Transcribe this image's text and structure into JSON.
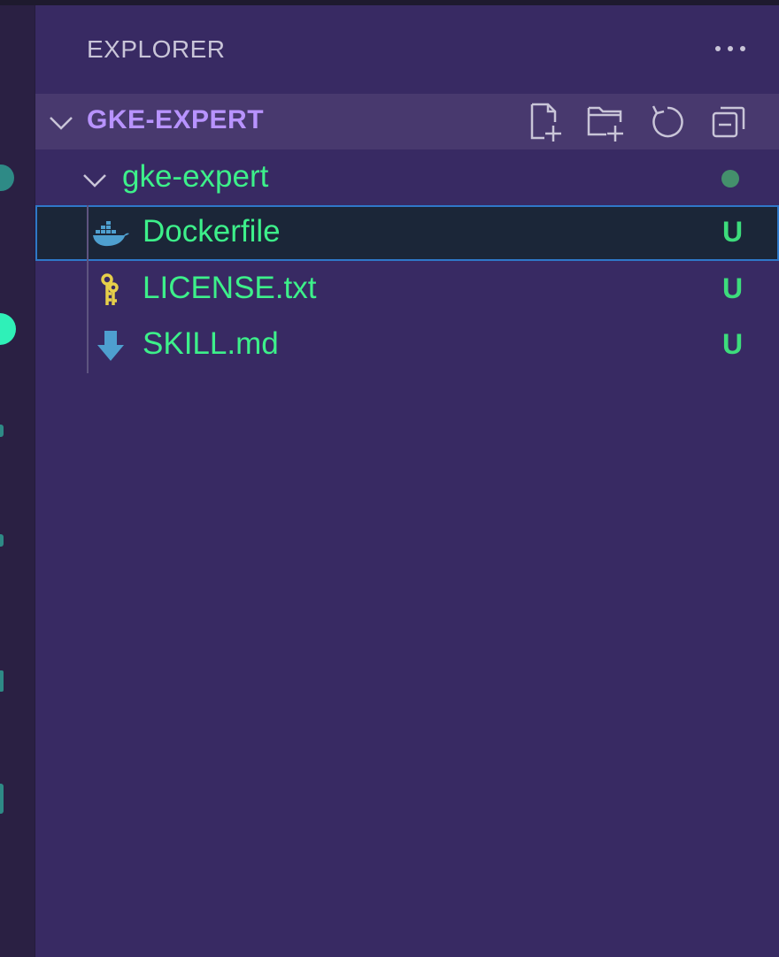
{
  "explorer": {
    "title": "EXPLORER",
    "more_actions_icon": "ellipsis-icon"
  },
  "workspace": {
    "name": "GKE-EXPERT",
    "expanded": true,
    "toolbar": [
      {
        "icon": "new-file-icon"
      },
      {
        "icon": "new-folder-icon"
      },
      {
        "icon": "refresh-icon"
      },
      {
        "icon": "collapse-all-icon"
      }
    ]
  },
  "tree": {
    "folder": {
      "name": "gke-expert",
      "expanded": true,
      "badge_icon": "modified-dot-icon"
    },
    "files": [
      {
        "name": "Dockerfile",
        "status": "U",
        "icon": "docker-icon",
        "selected": true
      },
      {
        "name": "LICENSE.txt",
        "status": "U",
        "icon": "keys-icon",
        "selected": false
      },
      {
        "name": "SKILL.md",
        "status": "U",
        "icon": "download-arrow-icon",
        "selected": false
      }
    ]
  },
  "colors": {
    "sidebar_bg": "#382a63",
    "workspace_label": "#b893ff",
    "untracked_text": "#3df08a",
    "status_u": "#3ddc7c",
    "selection_bg": "#1b2638",
    "selection_border": "#2f78c8"
  }
}
